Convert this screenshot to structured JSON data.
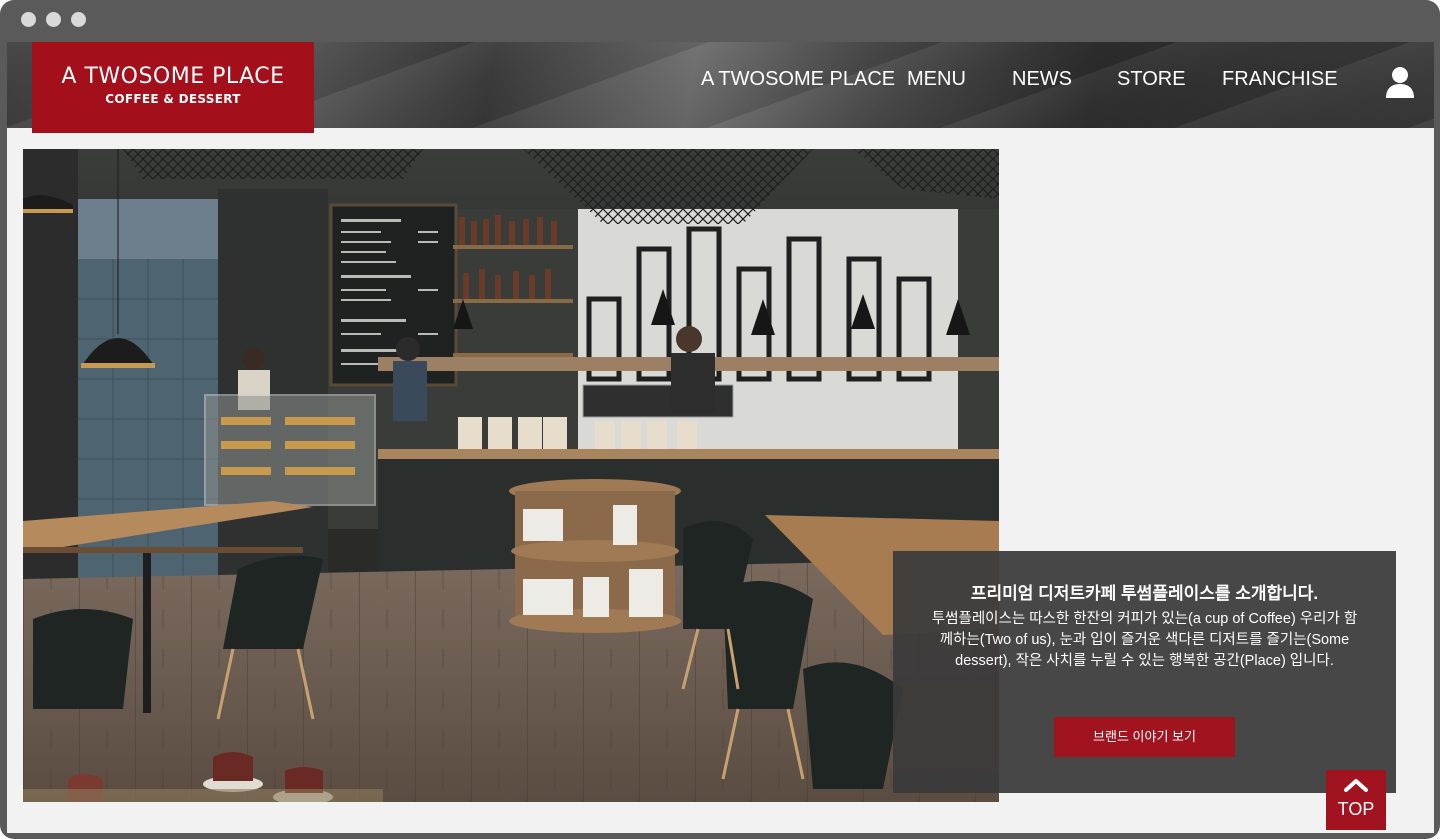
{
  "window": {
    "controls": [
      "close",
      "minimize",
      "maximize"
    ]
  },
  "header": {
    "logo": {
      "main": "A TWOSOME PLACE",
      "sub": "COFFEE & DESSERT"
    },
    "nav": [
      "A TWOSOME PLACE",
      "MENU",
      "NEWS",
      "STORE",
      "FRANCHISE"
    ],
    "user_icon": "user-icon"
  },
  "hero": {
    "image": "cafe-interior-photo"
  },
  "info": {
    "title": "프리미엄 디저트카페 투썸플레이스를 소개합니다.",
    "body": "투썸플레이스는 따스한 한잔의 커피가 있는(a cup of Coffee) 우리가 함께하는(Two of us), 눈과 입이 즐거운 색다른 디저트를 즐기는(Some dessert), 작은 사치를 누릴 수 있는 행복한 공간(Place) 입니다.",
    "button": "브랜드 이야기 보기"
  },
  "top_button": {
    "label": "TOP",
    "icon": "chevron-up-icon"
  },
  "colors": {
    "brand": "#a30f1a",
    "button": "#a1141f",
    "panel": "#3a3a3a"
  }
}
